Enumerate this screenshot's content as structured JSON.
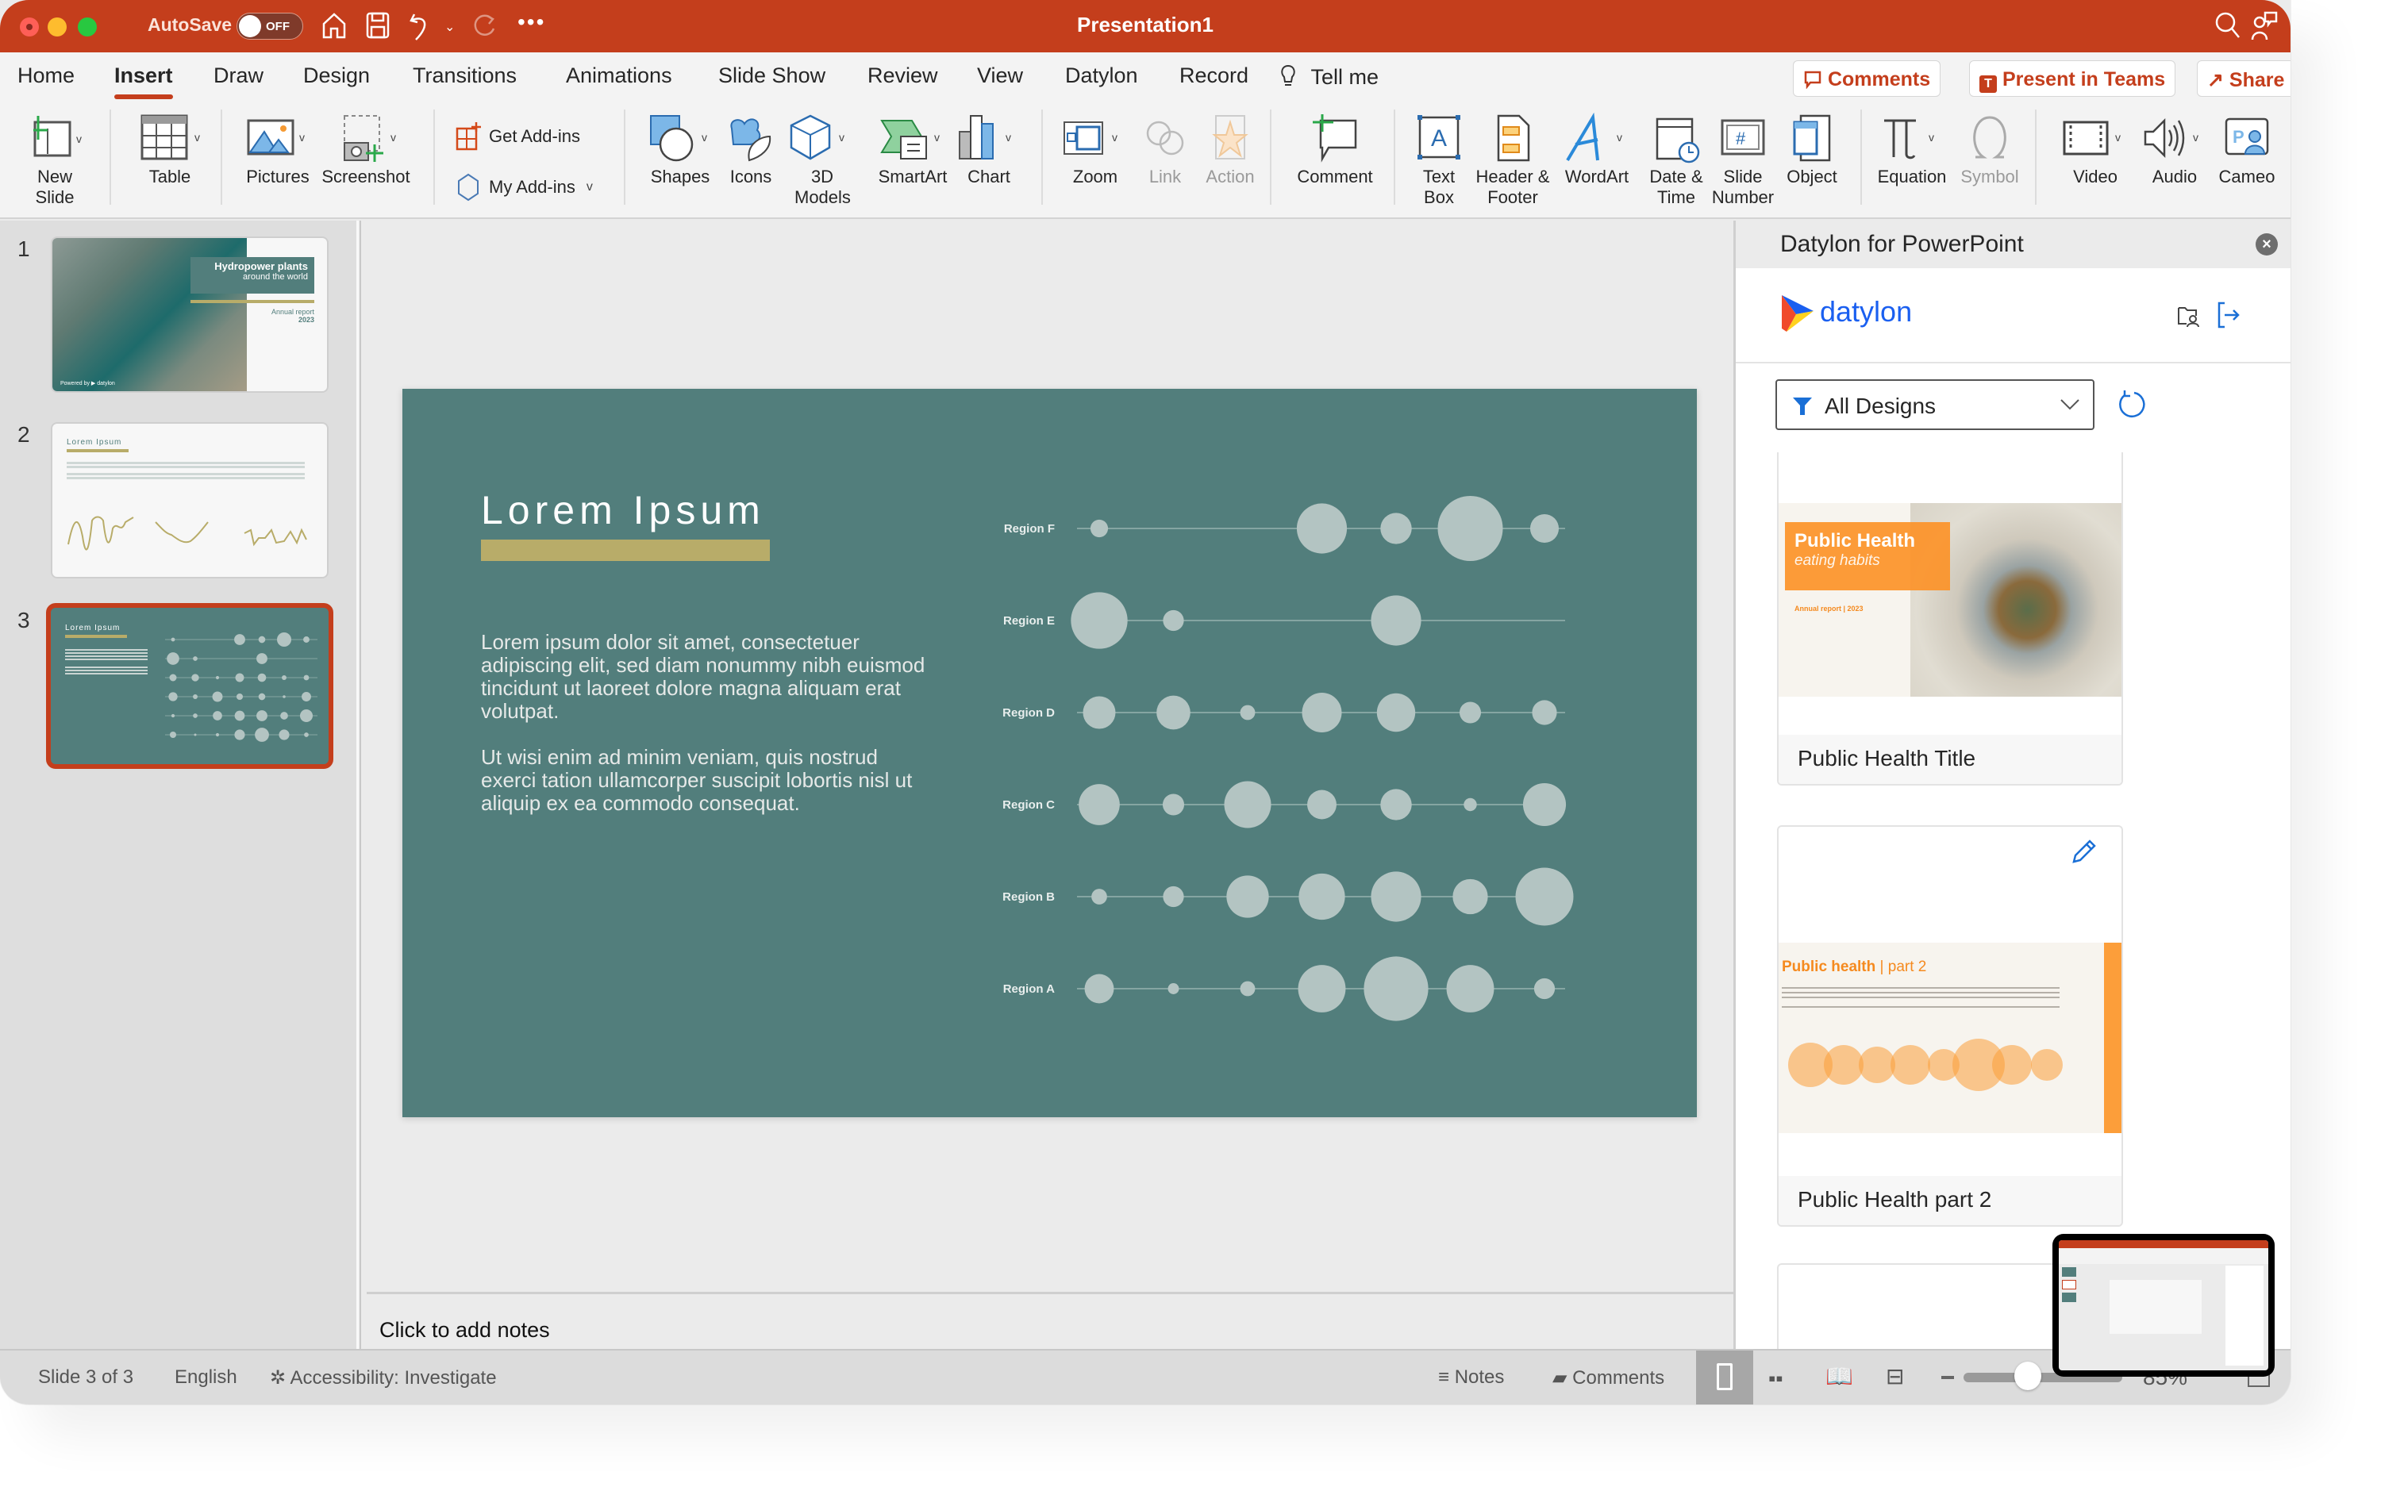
{
  "window": {
    "title": "Presentation1",
    "autosave_label": "AutoSave",
    "autosave_state": "OFF"
  },
  "menu_tabs": [
    "Home",
    "Insert",
    "Draw",
    "Design",
    "Transitions",
    "Animations",
    "Slide Show",
    "Review",
    "View",
    "Datylon",
    "Record"
  ],
  "active_tab": "Insert",
  "tell_me": "Tell me",
  "top_buttons": {
    "comments": "Comments",
    "present_teams": "Present in Teams",
    "share": "Share"
  },
  "ribbon": {
    "new_slide": "New Slide",
    "table": "Table",
    "pictures": "Pictures",
    "screenshot": "Screenshot",
    "get_addins": "Get Add-ins",
    "my_addins": "My Add-ins",
    "shapes": "Shapes",
    "icons": "Icons",
    "models3d": "3D Models",
    "smartart": "SmartArt",
    "chart": "Chart",
    "zoom": "Zoom",
    "link": "Link",
    "action": "Action",
    "comment": "Comment",
    "text_box": "Text Box",
    "header_footer": "Header & Footer",
    "wordart": "WordArt",
    "date_time": "Date & Time",
    "slide_number": "Slide Number",
    "object": "Object",
    "equation": "Equation",
    "symbol": "Symbol",
    "video": "Video",
    "audio": "Audio",
    "cameo": "Cameo"
  },
  "thumbnails": [
    {
      "number": "1",
      "title": "Hydropower plants",
      "subtitle": "around the world",
      "report": "Annual report",
      "year": "2023",
      "powered": "Powered by",
      "brand": "datylon"
    },
    {
      "number": "2",
      "title": "Lorem Ipsum"
    },
    {
      "number": "3",
      "title": "Lorem Ipsum",
      "selected": true
    }
  ],
  "slide": {
    "title": "Lorem Ipsum",
    "paragraphs": [
      "Lorem ipsum dolor sit amet, consectetuer adipiscing elit, sed diam nonummy nibh euismod tincidunt ut laoreet dolore magna aliquam erat volutpat.",
      "Ut wisi enim ad minim veniam, quis nostrud exerci tation ullamcorper suscipit lobortis nisl ut aliquip ex ea commodo consequat."
    ],
    "colors": {
      "background": "#527e7c",
      "accent": "#b8ac69",
      "bubble": "#b3c4c2"
    }
  },
  "chart_data": {
    "type": "scatter",
    "subtype": "bubble-rows",
    "title": "",
    "xlabel": "",
    "ylabel": "",
    "columns": 7,
    "categories": [
      "Region F",
      "Region E",
      "Region D",
      "Region C",
      "Region B",
      "Region A"
    ],
    "size_scale": "relative size, max = 100",
    "series": [
      {
        "name": "Region F",
        "values": [
          27,
          0,
          0,
          77,
          48,
          100,
          44
        ]
      },
      {
        "name": "Region E",
        "values": [
          87,
          32,
          0,
          0,
          77,
          0,
          0
        ]
      },
      {
        "name": "Region D",
        "values": [
          50,
          52,
          23,
          61,
          59,
          33,
          38
        ]
      },
      {
        "name": "Region C",
        "values": [
          63,
          33,
          72,
          45,
          48,
          20,
          66
        ]
      },
      {
        "name": "Region B",
        "values": [
          24,
          32,
          65,
          71,
          77,
          54,
          89
        ]
      },
      {
        "name": "Region A",
        "values": [
          45,
          17,
          23,
          73,
          99,
          73,
          32
        ]
      }
    ],
    "grid": false,
    "legend": "none"
  },
  "notes_placeholder": "Click to add notes",
  "pane": {
    "title": "Datylon for PowerPoint",
    "brand": "datylon",
    "filter_value": "All Designs",
    "cards": [
      {
        "label": "Public Health Title",
        "thumb_title": "Public Health",
        "thumb_subtitle": "eating habits",
        "thumb_meta": "Annual report | 2023"
      },
      {
        "label": "Public Health part 2",
        "thumb_title": "Public health",
        "thumb_title_suffix": "| part 2"
      }
    ]
  },
  "status": {
    "slide": "Slide 3 of 3",
    "language": "English",
    "accessibility": "Accessibility: Investigate",
    "notes": "Notes",
    "comments": "Comments",
    "zoom": "85%"
  }
}
